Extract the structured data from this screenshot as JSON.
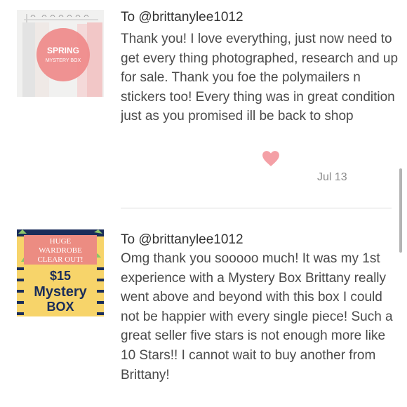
{
  "reviews": [
    {
      "thumbnail": {
        "line1": "SPRING",
        "line2": "MYSTERY BOX"
      },
      "to_line": "To @brittanylee1012",
      "message": "Thank you! I love everything, just now need to get every thing photographed, research and up for sale. Thank you foe the polymailers n stickers too! Every thing was in great condition just as you promised ill be back to shop",
      "liked": true,
      "heart_icon": "heart-icon",
      "date": "Jul 13"
    },
    {
      "thumbnail": {
        "line1": "HUGE",
        "line2": "WARDROBE",
        "line3": "CLEAR OUT!",
        "line4": "$15",
        "line5": "Mystery",
        "line6": "BOX"
      },
      "to_line": "To @brittanylee1012",
      "message": "Omg thank you sooooo much! It was my 1st experience with a Mystery Box Brittany really went above and beyond with this box I could not be happier with every single piece! Such a great seller five stars is not enough more like 10 Stars!! I cannot wait to buy another from Brittany!"
    }
  ],
  "colors": {
    "heart": "#f4a0a6",
    "accent_pink": "#ef8a8a",
    "thumb2_bg": "#f7d46a",
    "thumb2_top": "#ec8c82",
    "thumb2_stripe": "#1a2d5a"
  }
}
